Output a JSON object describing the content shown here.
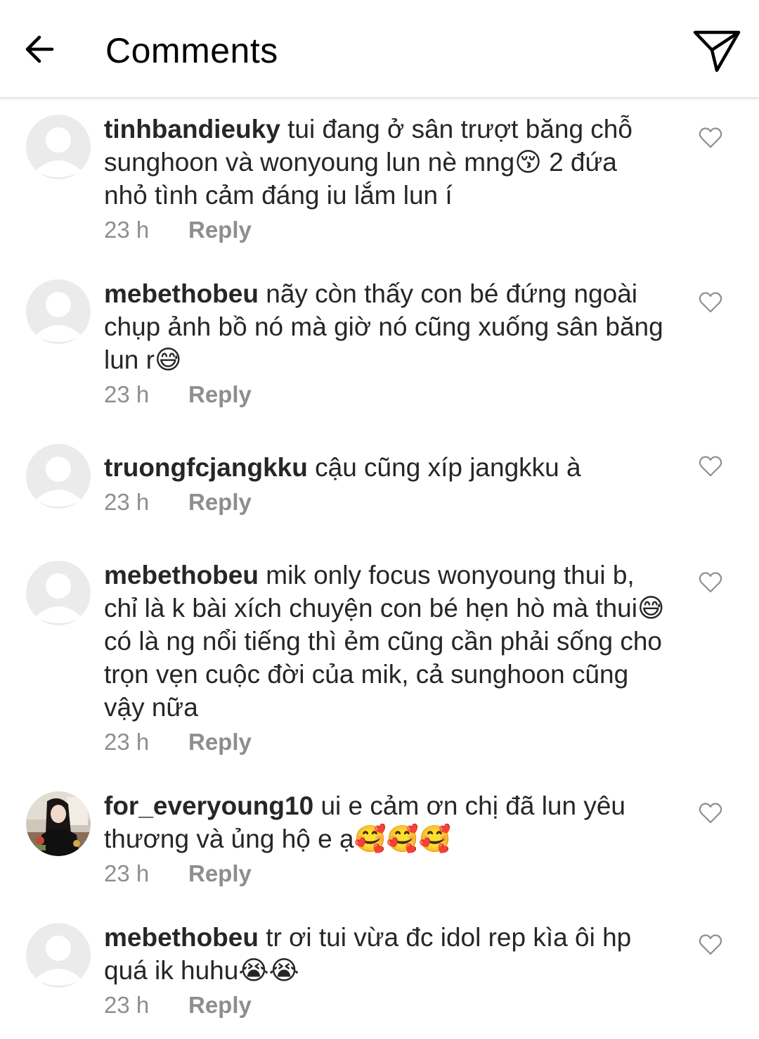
{
  "header": {
    "title": "Comments",
    "back_icon": "arrow-left-icon",
    "share_icon": "paper-plane-icon"
  },
  "comments": [
    {
      "username": "tinhbandieuky",
      "text": " tui đang ở sân trượt băng chỗ sunghoon và wonyoung lun nè mng😚 2 đứa nhỏ tình cảm đáng iu lắm lun í",
      "time": "23 h",
      "reply": "Reply"
    },
    {
      "username": "mebethobeu",
      "text": " nãy còn thấy con bé đứng ngoài chụp ảnh bồ nó mà giờ nó cũng xuống sân băng lun r😅",
      "time": "23 h",
      "reply": "Reply"
    },
    {
      "username": "truongfcjangkku",
      "text": " cậu cũng xíp jangkku à",
      "time": "23 h",
      "reply": "Reply"
    },
    {
      "username": "mebethobeu",
      "text": " mik only focus wonyoung thui b, chỉ là k bài xích chuyện con bé hẹn hò mà thui😅 có là ng nổi tiếng thì ẻm cũng cần phải sống cho trọn vẹn cuộc đời của mik, cả sunghoon cũng vậy nữa",
      "time": "23 h",
      "reply": "Reply"
    },
    {
      "username": "for_everyoung10",
      "text": " ui e cảm ơn chị đã lun yêu thương và ủng hộ e ạ🥰🥰🥰",
      "time": "23 h",
      "reply": "Reply"
    },
    {
      "username": "mebethobeu",
      "text": " tr ơi tui vừa đc idol rep kìa ôi hp quá ik huhu😭😭",
      "time": "23 h",
      "reply": "Reply"
    }
  ],
  "icons": {
    "like": "heart-outline-icon",
    "default_avatar": "default-avatar-icon"
  },
  "colors": {
    "text": "#262626",
    "meta": "#8e8e8e",
    "avatar_bg": "#ebebeb",
    "avatar_fg": "#ffffff"
  }
}
